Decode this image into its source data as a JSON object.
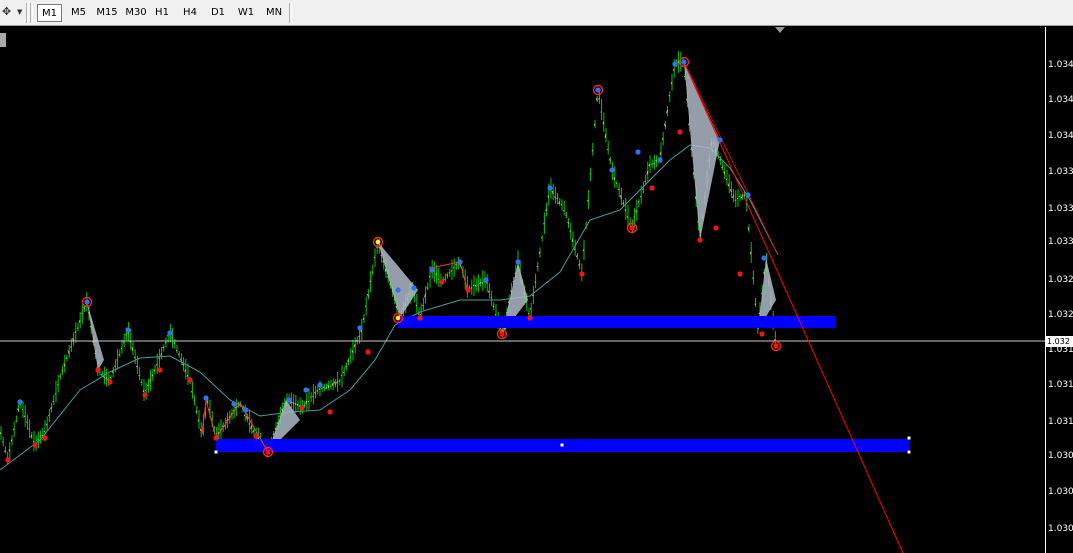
{
  "toolbar": {
    "timeframes": [
      "M1",
      "M5",
      "M15",
      "M30",
      "H1",
      "H4",
      "D1",
      "W1",
      "MN"
    ],
    "active": "M1"
  },
  "price_scale": {
    "labels": [
      "1.034",
      "1.034",
      "1.034",
      "1.033",
      "1.033",
      "1.033",
      "1.032",
      "1.032",
      "1.031",
      "1.031",
      "1.031",
      "1.030",
      "1.030",
      "1.030"
    ],
    "current_price": "1.032"
  },
  "colors": {
    "background": "#000000",
    "bull_bars": "#00c800",
    "bear_bars": "#00c800",
    "zone": "#0000ff",
    "trendline": "#ff0000",
    "moving_average": "#3fa0a0",
    "zigzag": "#2060ff",
    "harmonic_fill": "#b0b8c8",
    "swing_high_dot": "#3070ff",
    "swing_low_dot": "#ff1010"
  },
  "chart_data": {
    "type": "line",
    "description_series": [
      {
        "name": "",
        "values": [
          1.0304,
          1.0305,
          1.0306,
          1.031,
          1.0313,
          1.0318,
          1.032,
          1.0313,
          1.0312,
          1.0314,
          1.0315,
          1.031,
          1.0304,
          1.0303,
          1.0305,
          1.0308,
          1.0306,
          1.031,
          1.0315,
          1.032,
          1.0327,
          1.0322,
          1.0318,
          1.0322,
          1.0324,
          1.032,
          1.0319,
          1.0322,
          1.0325,
          1.0323,
          1.033,
          1.0335,
          1.0343,
          1.0336,
          1.0332,
          1.0335,
          1.0346,
          1.034,
          1.0333,
          1.0337,
          1.0331,
          1.0333,
          1.0325,
          1.0318,
          1.0319,
          1.0315,
          1.0319,
          1.0315
        ]
      }
    ],
    "ylim": [
      1.03,
      1.0348
    ],
    "zones": [
      {
        "from": 1.0318,
        "to": 1.032
      },
      {
        "from": 1.0304,
        "to": 1.0306
      }
    ],
    "grid": false
  }
}
